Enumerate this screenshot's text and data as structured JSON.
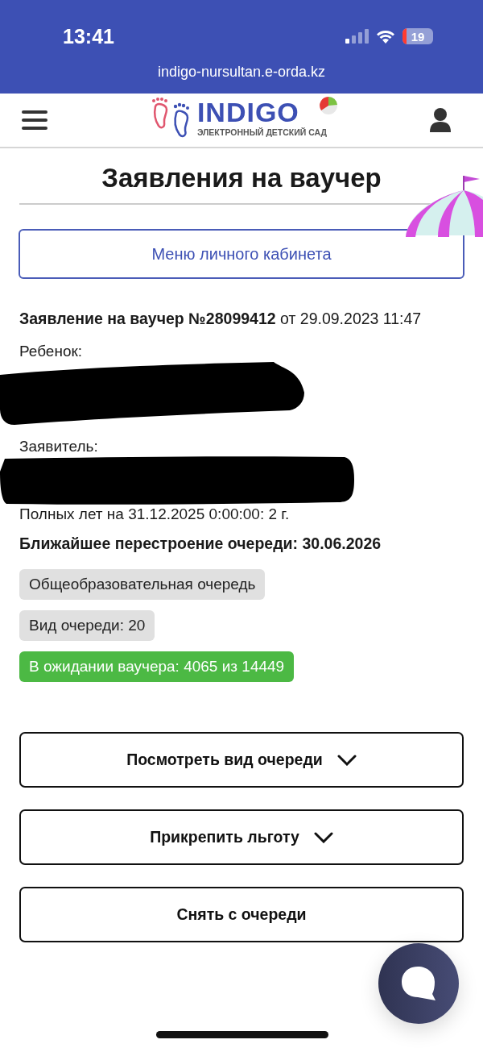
{
  "status_bar": {
    "time": "13:41",
    "battery": "19"
  },
  "browser": {
    "url": "indigo-nursultan.e-orda.kz"
  },
  "header": {
    "logo_title": "INDIGO",
    "logo_subtitle": "ЭЛЕКТРОННЫЙ ДЕТСКИЙ САД"
  },
  "page_title": "Заявления на ваучер",
  "menu_button": "Меню личного кабинета",
  "application": {
    "heading": "**Заявление на ваучер №28099412** от 29.09.2023 11:47",
    "child_label": "Ребенок:",
    "applicant_label": "Заявитель:",
    "age": "Полных лет на 31.12.2025 0:00:00: 2 г.",
    "next_rebuild": "Ближайшее перестроение очереди: 30.06.2026"
  },
  "badges": [
    {
      "text": "Общеобразовательная очередь",
      "color": "#e0e0e0"
    },
    {
      "text": "Вид очереди: 20",
      "color": "#e0e0e0"
    },
    {
      "text": "В ожидании ваучера: 4065 из 14449",
      "color": "#4cb944"
    }
  ],
  "actions": [
    {
      "label": "Посмотреть вид очереди",
      "kind": "dropdown"
    },
    {
      "label": "Прикрепить льготу",
      "kind": "dropdown"
    },
    {
      "label": "Снять с очереди",
      "kind": "plain"
    }
  ]
}
